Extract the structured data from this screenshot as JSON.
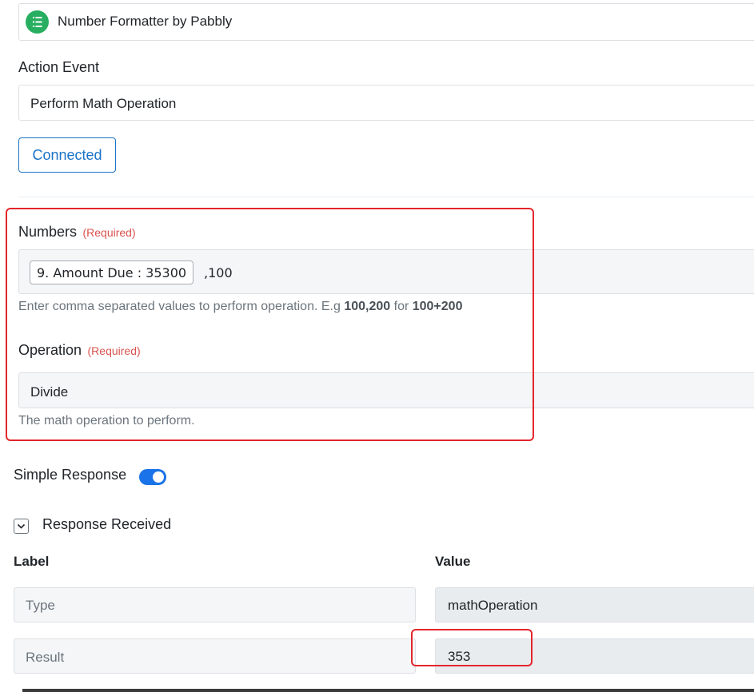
{
  "app": {
    "name": "Number Formatter by Pabbly",
    "icon": "list-number-icon",
    "icon_color": "#27ae60"
  },
  "action_event": {
    "label": "Action Event",
    "value": "Perform Math Operation"
  },
  "connection": {
    "button_label": "Connected",
    "color": "#1a73c8"
  },
  "numbers": {
    "label": "Numbers",
    "required": "(Required)",
    "token": "9. Amount Due : 35300",
    "suffix": ",100",
    "help_prefix": "Enter comma separated values to perform operation. E.g ",
    "help_ex1": "100,200",
    "help_mid": " for ",
    "help_ex2": "100+200"
  },
  "operation": {
    "label": "Operation",
    "required": "(Required)",
    "value": "Divide",
    "help": "The math operation to perform."
  },
  "simple_response": {
    "label": "Simple Response",
    "enabled": true,
    "toggle_color": "#1a73e8"
  },
  "response": {
    "title": "Response Received",
    "label_header": "Label",
    "value_header": "Value",
    "rows": [
      {
        "label": "Type",
        "value": "mathOperation"
      },
      {
        "label": "Result",
        "value": "353"
      }
    ]
  },
  "highlight_color": "#e3262c"
}
